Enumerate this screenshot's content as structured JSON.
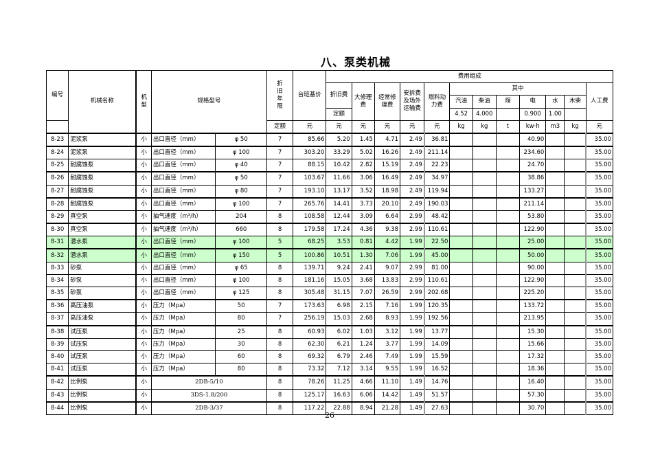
{
  "title": "八、泵类机械",
  "page_number": "26",
  "header": {
    "code": "编号",
    "name": "机械名称",
    "type": "机型",
    "spec": "规格型号",
    "years": "折旧年限",
    "years_unit": "定额",
    "base_price": "台班基价",
    "cost_group": "费用组成",
    "depreciation": "折旧费",
    "depreciation_sub": "定额",
    "major_repair": "大修理费",
    "regular_repair": "经常修理费",
    "install": "安拆费及场外运输费",
    "fuel": "燃料动力费",
    "among": "其中",
    "gasoline": "汽油",
    "diesel": "柴油",
    "coal": "煤",
    "electric": "电",
    "water": "水",
    "wood": "木柴",
    "labor": "人工费",
    "prices": {
      "gasoline": "4.52",
      "diesel": "4.000",
      "coal": "",
      "electric": "0.900",
      "water": "1.00",
      "wood": ""
    },
    "units": {
      "base_price": "元",
      "depreciation": "元",
      "major_repair": "元",
      "regular_repair": "元",
      "install": "元",
      "fuel": "元",
      "gasoline": "kg",
      "diesel": "kg",
      "coal": "t",
      "electric": "kw·h",
      "water": "m3",
      "wood": "kg",
      "labor": "元"
    }
  },
  "rows": [
    {
      "code": "8-23",
      "name": "泥浆泵",
      "type": "小",
      "spec_label": "出口直径（mm）",
      "spec_value": "φ 50",
      "years": "7",
      "base": "85.66",
      "dep": "5.20",
      "major": "1.45",
      "regular": "4.71",
      "install": "2.49",
      "fuel": "36.81",
      "gasoline": "",
      "diesel": "",
      "coal": "",
      "electric": "40.90",
      "water": "",
      "wood": "",
      "labor": "35.00",
      "highlight": false
    },
    {
      "code": "8-24",
      "name": "泥浆泵",
      "type": "小",
      "spec_label": "出口直径（mm）",
      "spec_value": "φ 100",
      "years": "7",
      "base": "303.20",
      "dep": "33.29",
      "major": "5.02",
      "regular": "16.26",
      "install": "2.49",
      "fuel": "211.14",
      "gasoline": "",
      "diesel": "",
      "coal": "",
      "electric": "234.60",
      "water": "",
      "wood": "",
      "labor": "35.00",
      "highlight": false
    },
    {
      "code": "8-25",
      "name": "耐腐蚀泵",
      "type": "小",
      "spec_label": "出口直径（mm）",
      "spec_value": "φ 40",
      "years": "7",
      "base": "88.15",
      "dep": "10.42",
      "major": "2.82",
      "regular": "15.19",
      "install": "2.49",
      "fuel": "22.23",
      "gasoline": "",
      "diesel": "",
      "coal": "",
      "electric": "24.70",
      "water": "",
      "wood": "",
      "labor": "35.00",
      "highlight": false
    },
    {
      "code": "8-26",
      "name": "耐腐蚀泵",
      "type": "小",
      "spec_label": "出口直径（mm）",
      "spec_value": "φ 50",
      "years": "7",
      "base": "103.67",
      "dep": "11.66",
      "major": "3.06",
      "regular": "16.49",
      "install": "2.49",
      "fuel": "34.97",
      "gasoline": "",
      "diesel": "",
      "coal": "",
      "electric": "38.86",
      "water": "",
      "wood": "",
      "labor": "35.00",
      "highlight": false
    },
    {
      "code": "8-27",
      "name": "耐腐蚀泵",
      "type": "小",
      "spec_label": "出口直径（mm）",
      "spec_value": "φ 80",
      "years": "7",
      "base": "193.10",
      "dep": "13.17",
      "major": "3.52",
      "regular": "18.98",
      "install": "2.49",
      "fuel": "119.94",
      "gasoline": "",
      "diesel": "",
      "coal": "",
      "electric": "133.27",
      "water": "",
      "wood": "",
      "labor": "35.00",
      "highlight": false
    },
    {
      "code": "8-28",
      "name": "耐腐蚀泵",
      "type": "小",
      "spec_label": "出口直径（mm）",
      "spec_value": "φ 100",
      "years": "7",
      "base": "265.76",
      "dep": "14.41",
      "major": "3.73",
      "regular": "20.10",
      "install": "2.49",
      "fuel": "190.03",
      "gasoline": "",
      "diesel": "",
      "coal": "",
      "electric": "211.14",
      "water": "",
      "wood": "",
      "labor": "35.00",
      "highlight": false
    },
    {
      "code": "8-29",
      "name": "真空泵",
      "type": "小",
      "spec_label": "抽气速度（m³/h）",
      "spec_value": "204",
      "years": "8",
      "base": "108.58",
      "dep": "12.44",
      "major": "3.09",
      "regular": "6.64",
      "install": "2.99",
      "fuel": "48.42",
      "gasoline": "",
      "diesel": "",
      "coal": "",
      "electric": "53.80",
      "water": "",
      "wood": "",
      "labor": "35.00",
      "highlight": false
    },
    {
      "code": "8-30",
      "name": "真空泵",
      "type": "小",
      "spec_label": "抽气速度（m³/h）",
      "spec_value": "660",
      "years": "8",
      "base": "179.58",
      "dep": "17.24",
      "major": "4.36",
      "regular": "9.38",
      "install": "2.99",
      "fuel": "110.61",
      "gasoline": "",
      "diesel": "",
      "coal": "",
      "electric": "122.90",
      "water": "",
      "wood": "",
      "labor": "35.00",
      "highlight": false
    },
    {
      "code": "8-31",
      "name": "潜水泵",
      "type": "小",
      "spec_label": "出口直径（mm）",
      "spec_value": "φ 100",
      "years": "5",
      "base": "68.25",
      "dep": "3.53",
      "major": "0.81",
      "regular": "4.42",
      "install": "1.99",
      "fuel": "22.50",
      "gasoline": "",
      "diesel": "",
      "coal": "",
      "electric": "25.00",
      "water": "",
      "wood": "",
      "labor": "35.00",
      "highlight": true
    },
    {
      "code": "8-32",
      "name": "潜水泵",
      "type": "小",
      "spec_label": "出口直径（mm）",
      "spec_value": "φ 150",
      "years": "5",
      "base": "100.86",
      "dep": "10.51",
      "major": "1.30",
      "regular": "7.06",
      "install": "1.99",
      "fuel": "45.00",
      "gasoline": "",
      "diesel": "",
      "coal": "",
      "electric": "50.00",
      "water": "",
      "wood": "",
      "labor": "35.00",
      "highlight": true
    },
    {
      "code": "8-33",
      "name": "砂泵",
      "type": "小",
      "spec_label": "出口直径（mm）",
      "spec_value": "φ 65",
      "years": "8",
      "base": "139.71",
      "dep": "9.24",
      "major": "2.41",
      "regular": "9.07",
      "install": "2.99",
      "fuel": "81.00",
      "gasoline": "",
      "diesel": "",
      "coal": "",
      "electric": "90.00",
      "water": "",
      "wood": "",
      "labor": "35.00",
      "highlight": false
    },
    {
      "code": "8-34",
      "name": "砂泵",
      "type": "小",
      "spec_label": "出口直径（mm）",
      "spec_value": "φ 100",
      "years": "8",
      "base": "181.16",
      "dep": "15.05",
      "major": "3.68",
      "regular": "13.83",
      "install": "2.99",
      "fuel": "110.61",
      "gasoline": "",
      "diesel": "",
      "coal": "",
      "electric": "122.90",
      "water": "",
      "wood": "",
      "labor": "35.00",
      "highlight": false
    },
    {
      "code": "8-35",
      "name": "砂泵",
      "type": "小",
      "spec_label": "出口直径（mm）",
      "spec_value": "φ 125",
      "years": "8",
      "base": "305.48",
      "dep": "31.15",
      "major": "7.07",
      "regular": "26.59",
      "install": "2.99",
      "fuel": "202.68",
      "gasoline": "",
      "diesel": "",
      "coal": "",
      "electric": "225.20",
      "water": "",
      "wood": "",
      "labor": "35.00",
      "highlight": false
    },
    {
      "code": "8-36",
      "name": "高压油泵",
      "type": "小",
      "spec_label": "压力（Mpa）",
      "spec_value": "50",
      "years": "7",
      "base": "173.63",
      "dep": "6.98",
      "major": "2.15",
      "regular": "7.16",
      "install": "1.99",
      "fuel": "120.35",
      "gasoline": "",
      "diesel": "",
      "coal": "",
      "electric": "133.72",
      "water": "",
      "wood": "",
      "labor": "35.00",
      "highlight": false
    },
    {
      "code": "8-37",
      "name": "高压油泵",
      "type": "小",
      "spec_label": "压力（Mpa）",
      "spec_value": "80",
      "years": "7",
      "base": "256.19",
      "dep": "15.03",
      "major": "2.68",
      "regular": "8.93",
      "install": "1.99",
      "fuel": "192.56",
      "gasoline": "",
      "diesel": "",
      "coal": "",
      "electric": "213.95",
      "water": "",
      "wood": "",
      "labor": "35.00",
      "highlight": false
    },
    {
      "code": "8-38",
      "name": "试压泵",
      "type": "小",
      "spec_label": "压力（Mpa）",
      "spec_value": "25",
      "years": "8",
      "base": "60.93",
      "dep": "6.02",
      "major": "1.03",
      "regular": "3.12",
      "install": "1.99",
      "fuel": "13.77",
      "gasoline": "",
      "diesel": "",
      "coal": "",
      "electric": "15.30",
      "water": "",
      "wood": "",
      "labor": "35.00",
      "highlight": false
    },
    {
      "code": "8-39",
      "name": "试压泵",
      "type": "小",
      "spec_label": "压力（Mpa）",
      "spec_value": "30",
      "years": "8",
      "base": "62.30",
      "dep": "6.21",
      "major": "1.24",
      "regular": "3.77",
      "install": "1.99",
      "fuel": "14.09",
      "gasoline": "",
      "diesel": "",
      "coal": "",
      "electric": "15.66",
      "water": "",
      "wood": "",
      "labor": "35.00",
      "highlight": false
    },
    {
      "code": "8-40",
      "name": "试压泵",
      "type": "小",
      "spec_label": "压力（Mpa）",
      "spec_value": "60",
      "years": "8",
      "base": "69.32",
      "dep": "6.79",
      "major": "2.46",
      "regular": "7.49",
      "install": "1.99",
      "fuel": "15.59",
      "gasoline": "",
      "diesel": "",
      "coal": "",
      "electric": "17.32",
      "water": "",
      "wood": "",
      "labor": "35.00",
      "highlight": false
    },
    {
      "code": "8-41",
      "name": "试压泵",
      "type": "小",
      "spec_label": "压力（Mpa）",
      "spec_value": "80",
      "years": "8",
      "base": "73.32",
      "dep": "7.12",
      "major": "3.14",
      "regular": "9.55",
      "install": "1.99",
      "fuel": "16.52",
      "gasoline": "",
      "diesel": "",
      "coal": "",
      "electric": "18.36",
      "water": "",
      "wood": "",
      "labor": "35.00",
      "highlight": false
    },
    {
      "code": "8-42",
      "name": "比例泵",
      "type": "小",
      "spec_full": "2DB-5/10",
      "years": "8",
      "base": "78.26",
      "dep": "11.25",
      "major": "4.66",
      "regular": "11.10",
      "install": "1.49",
      "fuel": "14.76",
      "gasoline": "",
      "diesel": "",
      "coal": "",
      "electric": "16.40",
      "water": "",
      "wood": "",
      "labor": "35.00",
      "highlight": false
    },
    {
      "code": "8-43",
      "name": "比例泵",
      "type": "小",
      "spec_full": "3DS-1.8/200",
      "years": "8",
      "base": "125.17",
      "dep": "16.63",
      "major": "6.06",
      "regular": "14.42",
      "install": "1.49",
      "fuel": "51.57",
      "gasoline": "",
      "diesel": "",
      "coal": "",
      "electric": "57.30",
      "water": "",
      "wood": "",
      "labor": "35.00",
      "highlight": false
    },
    {
      "code": "8-44",
      "name": "比例泵",
      "type": "小",
      "spec_full": "2DB-3/37",
      "years": "8",
      "base": "117.22",
      "dep": "22.88",
      "major": "8.94",
      "regular": "21.28",
      "install": "1.49",
      "fuel": "27.63",
      "gasoline": "",
      "diesel": "",
      "coal": "",
      "electric": "30.70",
      "water": "",
      "wood": "",
      "labor": "35.00",
      "highlight": false
    }
  ]
}
